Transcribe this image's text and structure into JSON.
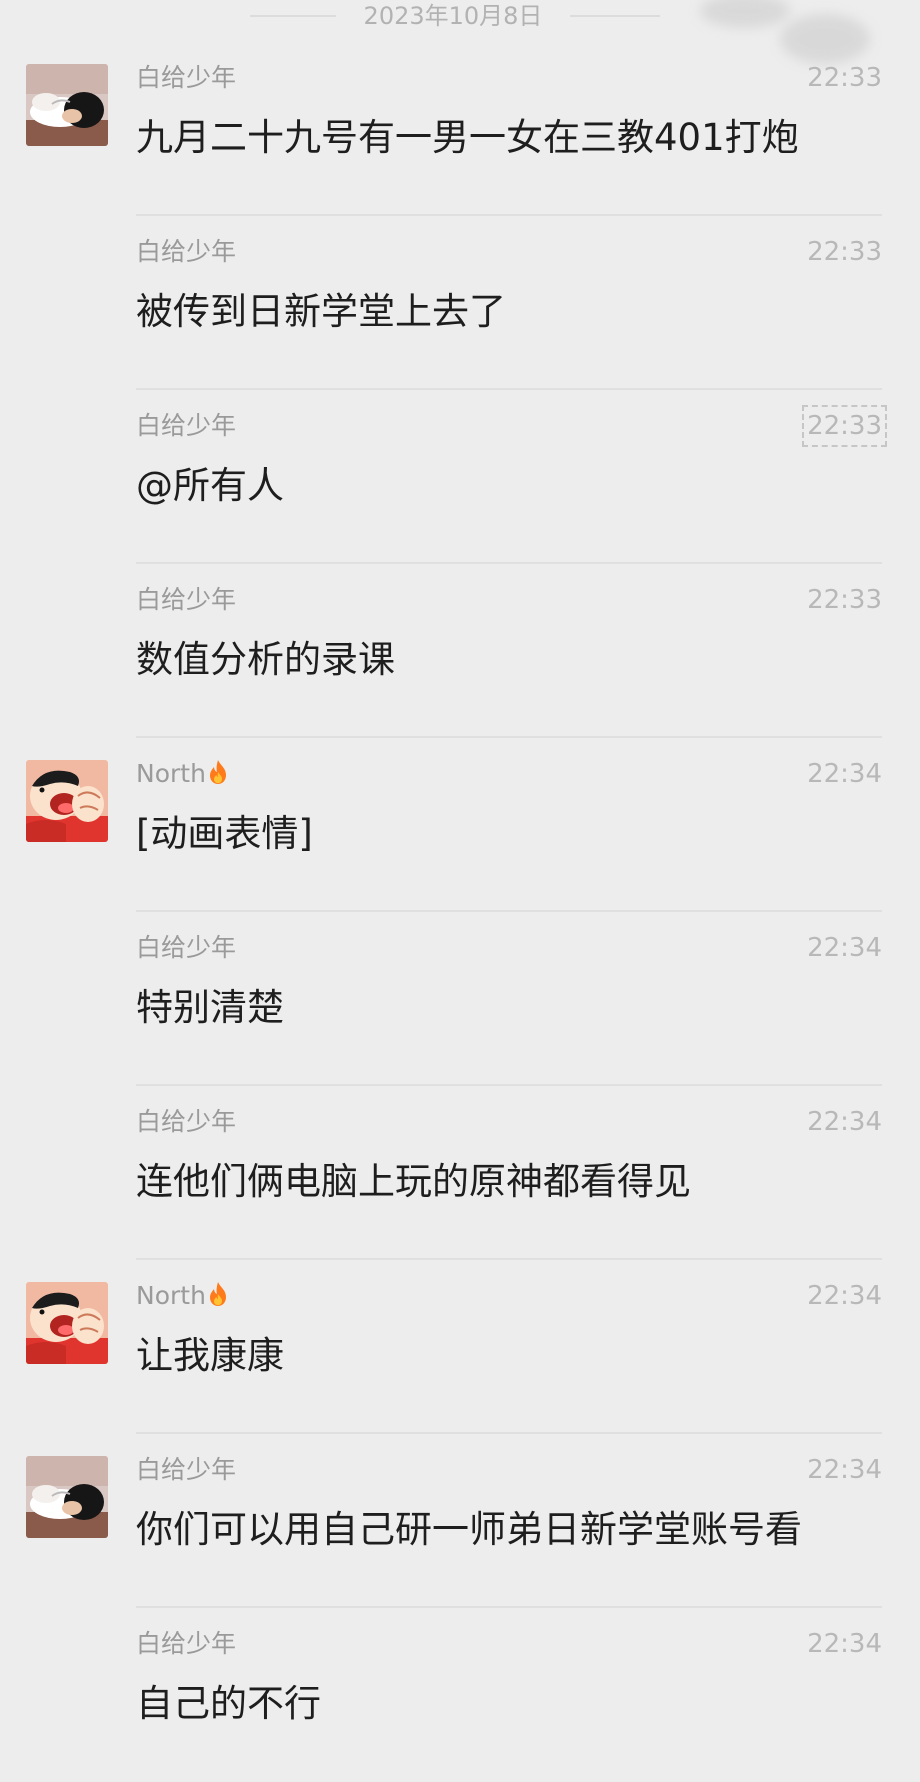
{
  "date_separator": "2023年10月8日",
  "messages": [
    {
      "sender": "白给少年",
      "avatar": "sleeping-person-avatar",
      "show_avatar": true,
      "time": "22:33",
      "text": "九月二十九号有一男一女在三教401打炮"
    },
    {
      "sender": "白给少年",
      "avatar": "sleeping-person-avatar",
      "show_avatar": false,
      "time": "22:33",
      "text": "被传到日新学堂上去了"
    },
    {
      "sender": "白给少年",
      "avatar": "sleeping-person-avatar",
      "show_avatar": false,
      "time": "22:33",
      "text": "@所有人",
      "time_selected": true
    },
    {
      "sender": "白给少年",
      "avatar": "sleeping-person-avatar",
      "show_avatar": false,
      "time": "22:33",
      "text": "数值分析的录课"
    },
    {
      "sender": "North",
      "avatar": "cartoon-boy-avatar",
      "show_avatar": true,
      "time": "22:34",
      "text": "[动画表情]",
      "flame": true
    },
    {
      "sender": "白给少年",
      "avatar": "sleeping-person-avatar",
      "show_avatar": false,
      "time": "22:34",
      "text": "特别清楚"
    },
    {
      "sender": "白给少年",
      "avatar": "sleeping-person-avatar",
      "show_avatar": false,
      "time": "22:34",
      "text": "连他们俩电脑上玩的原神都看得见"
    },
    {
      "sender": "North",
      "avatar": "cartoon-boy-avatar",
      "show_avatar": true,
      "time": "22:34",
      "text": "让我康康",
      "flame": true
    },
    {
      "sender": "白给少年",
      "avatar": "sleeping-person-avatar",
      "show_avatar": true,
      "time": "22:34",
      "text": "你们可以用自己研一师弟日新学堂账号看"
    },
    {
      "sender": "白给少年",
      "avatar": "sleeping-person-avatar",
      "show_avatar": false,
      "time": "22:34",
      "text": "自己的不行"
    }
  ],
  "colors": {
    "background": "#ededed",
    "sender": "#9a9a9a",
    "time": "#b8b8b8",
    "text": "#1e1e1e",
    "divider": "#e0e0e0",
    "flame": "#ff7a1a"
  }
}
